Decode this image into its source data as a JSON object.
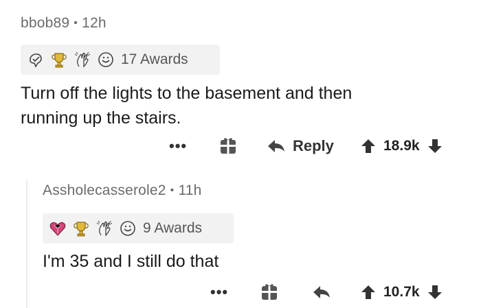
{
  "comments": [
    {
      "username": "bbob89",
      "separator": "•",
      "time": "12h",
      "awards": {
        "icons": [
          "helpful-award-icon",
          "gold-trophy-award-icon",
          "clapping-hands-award-icon",
          "smile-award-icon"
        ],
        "label": "17 Awards"
      },
      "body_lines": [
        "Turn off the lights to the basement and then",
        "running up the stairs."
      ],
      "toolbar": {
        "more": "•••",
        "reply": "Reply",
        "score": "18.9k"
      }
    },
    {
      "username": "Assholecasserole2",
      "separator": "•",
      "time": "11h",
      "awards": {
        "icons": [
          "heart-gem-award-icon",
          "gold-trophy-award-icon",
          "clapping-hands-award-icon",
          "smile-award-icon"
        ],
        "label": "9 Awards"
      },
      "body_lines": [
        "I'm 35 and I still do that"
      ],
      "toolbar": {
        "more": "•••",
        "reply": "",
        "score": "10.7k"
      }
    }
  ],
  "colors": {
    "meta_text": "#6b6b6b",
    "awards_bg": "#f2f2f3",
    "gold": "#e2b93b",
    "heart": "#d6457a"
  }
}
